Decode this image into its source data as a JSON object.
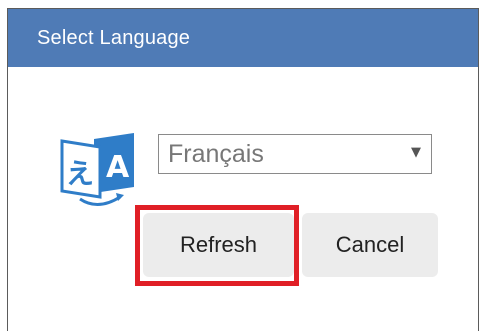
{
  "dialog": {
    "title": "Select Language"
  },
  "language_select": {
    "selected": "Français",
    "icon": "translate-icon",
    "arrow_icon": "dropdown-arrow-icon"
  },
  "buttons": {
    "refresh_label": "Refresh",
    "cancel_label": "Cancel"
  },
  "colors": {
    "titlebar": "#4f7bb6",
    "icon_blue": "#2f7dc8",
    "highlight": "#e01f26",
    "button_bg": "#ececec"
  }
}
